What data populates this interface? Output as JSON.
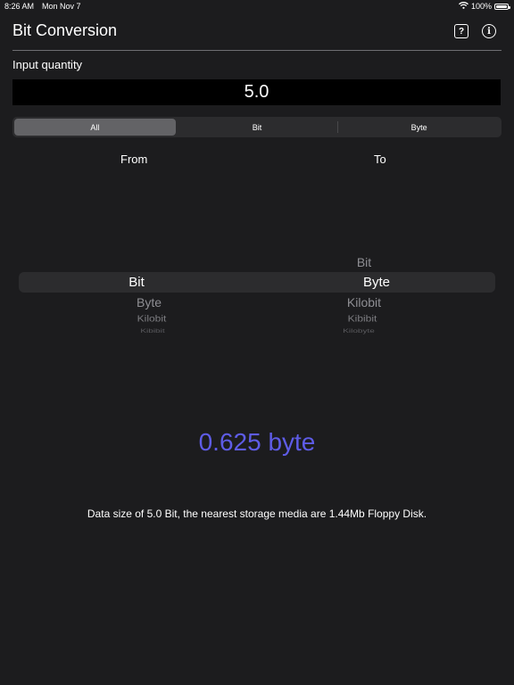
{
  "status_bar": {
    "time": "8:26 AM",
    "date": "Mon Nov 7",
    "battery": "100%",
    "wifi_icon": "wifi-icon",
    "battery_icon": "battery-icon"
  },
  "nav": {
    "title": "Bit Conversion",
    "help_icon": "question-square-icon",
    "help_glyph": "?",
    "info_icon": "info-circle-icon",
    "info_glyph": "i"
  },
  "input": {
    "label": "Input quantity",
    "value": "5.0"
  },
  "filter": {
    "segments": [
      "All",
      "Bit",
      "Byte"
    ],
    "selected": "All"
  },
  "picker": {
    "from_label": "From",
    "to_label": "To",
    "from": {
      "selected": "Bit",
      "below": [
        "Byte",
        "Kilobit",
        "Kibibit"
      ]
    },
    "to": {
      "above": [
        "Bit"
      ],
      "selected": "Byte",
      "below": [
        "Kilobit",
        "Kibibit",
        "Kilobyte"
      ]
    }
  },
  "result": {
    "text": "0.625 byte",
    "color": "#5e5ce6"
  },
  "description": "Data size of 5.0 Bit, the nearest storage media are 1.44Mb Floppy Disk.",
  "colors": {
    "background": "#1c1c1e",
    "accent": "#5e5ce6"
  }
}
